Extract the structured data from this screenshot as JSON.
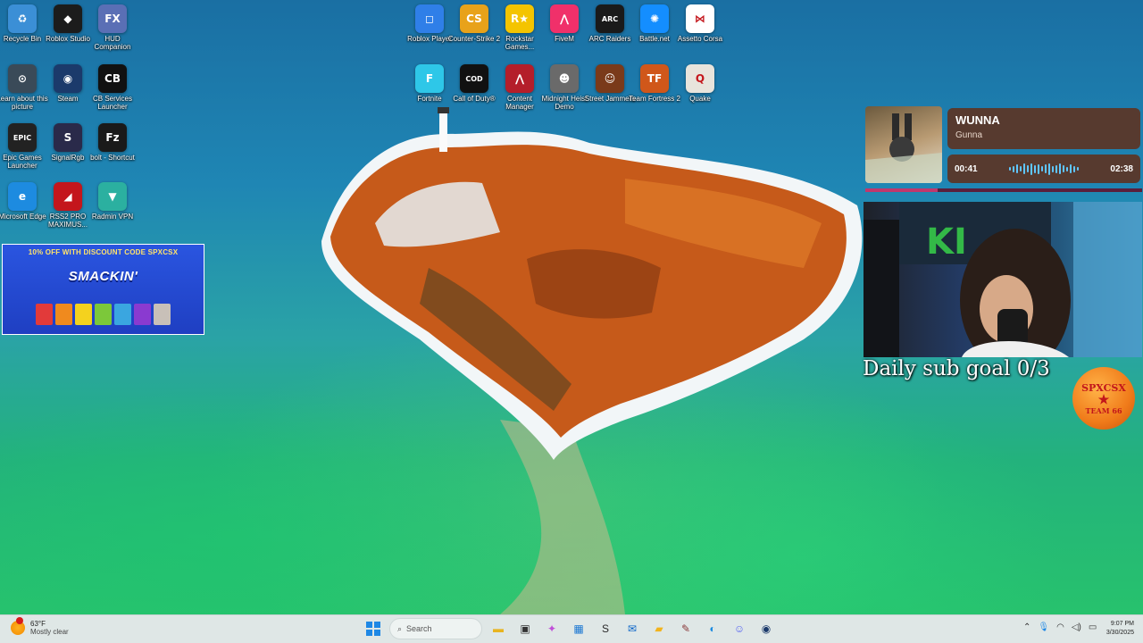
{
  "desktop_icons": [
    {
      "label": "Recycle Bin",
      "icon": "recycle-bin-icon",
      "color": "#3b8fd6",
      "glyph": "♻"
    },
    {
      "label": "Roblox Studio",
      "icon": "roblox-studio-icon",
      "color": "#1c1c1c",
      "glyph": "◆"
    },
    {
      "label": "HUD Companion",
      "icon": "hud-companion-icon",
      "color": "#5a6fb5",
      "glyph": "FX"
    },
    {
      "label": "Learn about this picture",
      "icon": "learn-picture-icon",
      "color": "#3a4a58",
      "glyph": "⊙"
    },
    {
      "label": "Steam",
      "icon": "steam-icon",
      "color": "#1b3a6b",
      "glyph": "◉"
    },
    {
      "label": "CB Services Launcher",
      "icon": "cb-launcher-icon",
      "color": "#111111",
      "glyph": "CB"
    },
    {
      "label": "Epic Games Launcher",
      "icon": "epic-games-icon",
      "color": "#222222",
      "glyph": "EPIC"
    },
    {
      "label": "SignalRgb",
      "icon": "signalrgb-icon",
      "color": "#2a2a4a",
      "glyph": "S"
    },
    {
      "label": "bolt - Shortcut",
      "icon": "filezilla-icon",
      "color": "#1a1a1a",
      "glyph": "Fz"
    },
    {
      "label": "Microsoft Edge",
      "icon": "edge-icon",
      "color": "#1d8be0",
      "glyph": "e"
    },
    {
      "label": "RSS2 PRO MAXIMUS...",
      "icon": "rss-pro-icon",
      "color": "#c4161c",
      "glyph": "◢"
    },
    {
      "label": "Radmin VPN",
      "icon": "radmin-vpn-icon",
      "color": "#2bb0a0",
      "glyph": "▼"
    },
    {
      "label": "Roblox Player",
      "icon": "roblox-player-icon",
      "color": "#2f7fe8",
      "glyph": "◻"
    },
    {
      "label": "Counter-Strike 2",
      "icon": "counter-strike-icon",
      "color": "#e8a21a",
      "glyph": "CS"
    },
    {
      "label": "Rockstar Games...",
      "icon": "rockstar-icon",
      "color": "#f4c400",
      "glyph": "R★"
    },
    {
      "label": "FiveM",
      "icon": "fivem-icon",
      "color": "#f0306a",
      "glyph": "⋀"
    },
    {
      "label": "ARC Raiders",
      "icon": "arc-raiders-icon",
      "color": "#1a1a1a",
      "glyph": "ARC"
    },
    {
      "label": "Battle.net",
      "icon": "battlenet-icon",
      "color": "#148eff",
      "glyph": "✺"
    },
    {
      "label": "Assetto Corsa",
      "icon": "assetto-corsa-icon",
      "color": "#ffffff",
      "glyph": "⋈"
    },
    {
      "label": "Fortnite",
      "icon": "fortnite-icon",
      "color": "#2ec7e8",
      "glyph": "F"
    },
    {
      "label": "Call of Duty®",
      "icon": "call-of-duty-icon",
      "color": "#111111",
      "glyph": "COD"
    },
    {
      "label": "Content Manager",
      "icon": "content-manager-icon",
      "color": "#b41e2a",
      "glyph": "⋀"
    },
    {
      "label": "Midnight Heist Demo",
      "icon": "midnight-heist-icon",
      "color": "#6a6a6a",
      "glyph": "☻"
    },
    {
      "label": "Street Jammers",
      "icon": "street-jammers-icon",
      "color": "#7a3a1a",
      "glyph": "☺"
    },
    {
      "label": "Team Fortress 2",
      "icon": "team-fortress-icon",
      "color": "#d0571a",
      "glyph": "TF"
    },
    {
      "label": "Quake",
      "icon": "quake-icon",
      "color": "#e8e4dc",
      "glyph": "Q"
    }
  ],
  "ad": {
    "promo": "10% OFF WITH DISCOUNT CODE SPXCSX",
    "brand": "SMACKIN'"
  },
  "music": {
    "title": "WUNNA",
    "artist": "Gunna",
    "elapsed": "00:41",
    "duration": "02:38",
    "progress": 0.26
  },
  "overlay": {
    "goal_text": "Daily sub goal 0/3",
    "badge_top": "SPXCSX",
    "badge_mid": "★",
    "badge_bottom": "TEAM 66"
  },
  "taskbar": {
    "weather_temp": "63°F",
    "weather_condition": "Mostly clear",
    "search_placeholder": "Search",
    "apps": [
      {
        "icon": "file-explorer-icon",
        "glyph": "▬",
        "color": "#e8b420"
      },
      {
        "icon": "task-view-icon",
        "glyph": "▣",
        "color": "#333333"
      },
      {
        "icon": "copilot-icon",
        "glyph": "✦",
        "color": "#c04fd8"
      },
      {
        "icon": "store-icon",
        "glyph": "▦",
        "color": "#1976d2"
      },
      {
        "icon": "stocks-icon",
        "glyph": "S",
        "color": "#2a2a2a"
      },
      {
        "icon": "outlook-icon",
        "glyph": "✉",
        "color": "#0a64c8"
      },
      {
        "icon": "folder-icon",
        "glyph": "▰",
        "color": "#f2b31c"
      },
      {
        "icon": "paint-icon",
        "glyph": "✎",
        "color": "#8a3a3a"
      },
      {
        "icon": "edge-taskbar-icon",
        "glyph": "◐",
        "color": "#1d8be0"
      },
      {
        "icon": "discord-icon",
        "glyph": "☺",
        "color": "#5865f2"
      },
      {
        "icon": "steam-taskbar-icon",
        "glyph": "◉",
        "color": "#1b3a6b"
      }
    ],
    "time": "9:07 PM",
    "date": "3/30/2025"
  }
}
